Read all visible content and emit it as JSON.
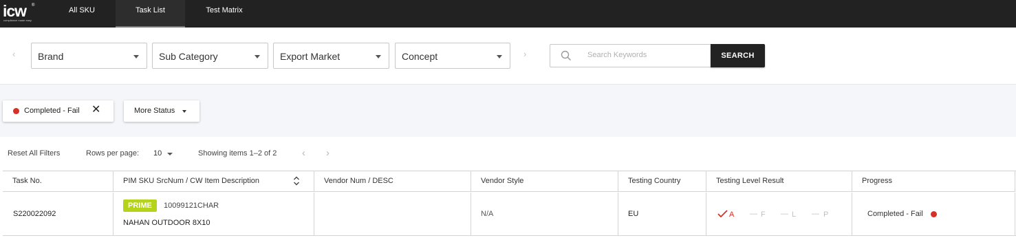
{
  "app": {
    "logo_text": "icw",
    "logo_tagline": "compliance made easy",
    "logo_mark": "®"
  },
  "nav": {
    "items": [
      {
        "label": "All SKU",
        "active": false
      },
      {
        "label": "Task List",
        "active": true
      },
      {
        "label": "Test Matrix",
        "active": false
      }
    ]
  },
  "filters": {
    "prev_icon": "chevron-left-icon",
    "next_icon": "chevron-right-icon",
    "selects": [
      {
        "label": "Brand"
      },
      {
        "label": "Sub Category"
      },
      {
        "label": "Export Market"
      },
      {
        "label": "Concept"
      }
    ],
    "search": {
      "placeholder": "Search Keywords",
      "value": "",
      "button_label": "SEARCH"
    }
  },
  "status_filters": {
    "active_chip": {
      "label": "Completed - Fail",
      "dot_color": "#d93025"
    },
    "more_label": "More Status"
  },
  "toolbar": {
    "reset_label": "Reset All Filters",
    "rows_per_page_label": "Rows per page:",
    "rows_per_page_value": "10",
    "showing_text": "Showing items 1–2 of 2"
  },
  "table": {
    "columns": [
      "Task No.",
      "PIM SKU SrcNum / CW Item Description",
      "Vendor Num / DESC",
      "Vendor Style",
      "Testing Country",
      "Testing Level Result",
      "Progress"
    ],
    "rows": [
      {
        "task_no": "S220022092",
        "badge": "PRIME",
        "sku": "10099121CHAR",
        "description": "NAHAN OUTDOOR 8X10",
        "vendor": "",
        "vendor_style": "N/A",
        "testing_country": "EU",
        "levels": [
          {
            "label": "A",
            "result": "fail"
          },
          {
            "label": "F",
            "result": "none"
          },
          {
            "label": "L",
            "result": "none"
          },
          {
            "label": "P",
            "result": "none"
          }
        ],
        "progress": "Completed - Fail",
        "progress_color": "#d93025"
      }
    ]
  },
  "colors": {
    "topbar": "#222222",
    "accent_badge": "#b5d31a",
    "fail": "#d93025"
  }
}
